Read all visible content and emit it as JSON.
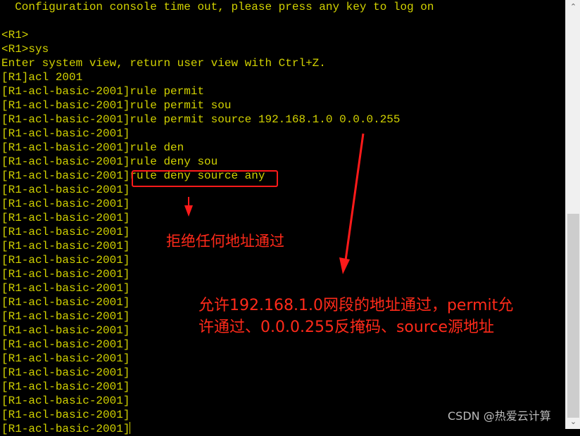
{
  "terminal": {
    "lines": [
      "  Configuration console time out, please press any key to log on",
      "",
      "<R1>",
      "<R1>sys",
      "Enter system view, return user view with Ctrl+Z.",
      "[R1]acl 2001",
      "[R1-acl-basic-2001]rule permit",
      "[R1-acl-basic-2001]rule permit sou",
      "[R1-acl-basic-2001]rule permit source 192.168.1.0 0.0.0.255",
      "[R1-acl-basic-2001]",
      "[R1-acl-basic-2001]rule den",
      "[R1-acl-basic-2001]rule deny sou",
      "[R1-acl-basic-2001]rule deny source any",
      "[R1-acl-basic-2001]",
      "[R1-acl-basic-2001]",
      "[R1-acl-basic-2001]",
      "[R1-acl-basic-2001]",
      "[R1-acl-basic-2001]",
      "[R1-acl-basic-2001]",
      "[R1-acl-basic-2001]",
      "[R1-acl-basic-2001]",
      "[R1-acl-basic-2001]",
      "[R1-acl-basic-2001]",
      "[R1-acl-basic-2001]",
      "[R1-acl-basic-2001]",
      "[R1-acl-basic-2001]",
      "[R1-acl-basic-2001]",
      "[R1-acl-basic-2001]",
      "[R1-acl-basic-2001]",
      "[R1-acl-basic-2001]",
      "[R1-acl-basic-2001]"
    ],
    "text_color": "#d2d200"
  },
  "annotations": {
    "deny_note": "拒绝任何地址通过",
    "permit_note_line1": "允许192.168.1.0网段的地址通过，permit允",
    "permit_note_line2": "许通过、0.0.0.255反掩码、source源地址",
    "color": "#ff2a1a"
  },
  "scrollbar": {
    "up_icon": "chevron-up-icon",
    "down_icon": "chevron-down-icon",
    "position_percent": 100
  },
  "watermark": "CSDN @热爱云计算"
}
